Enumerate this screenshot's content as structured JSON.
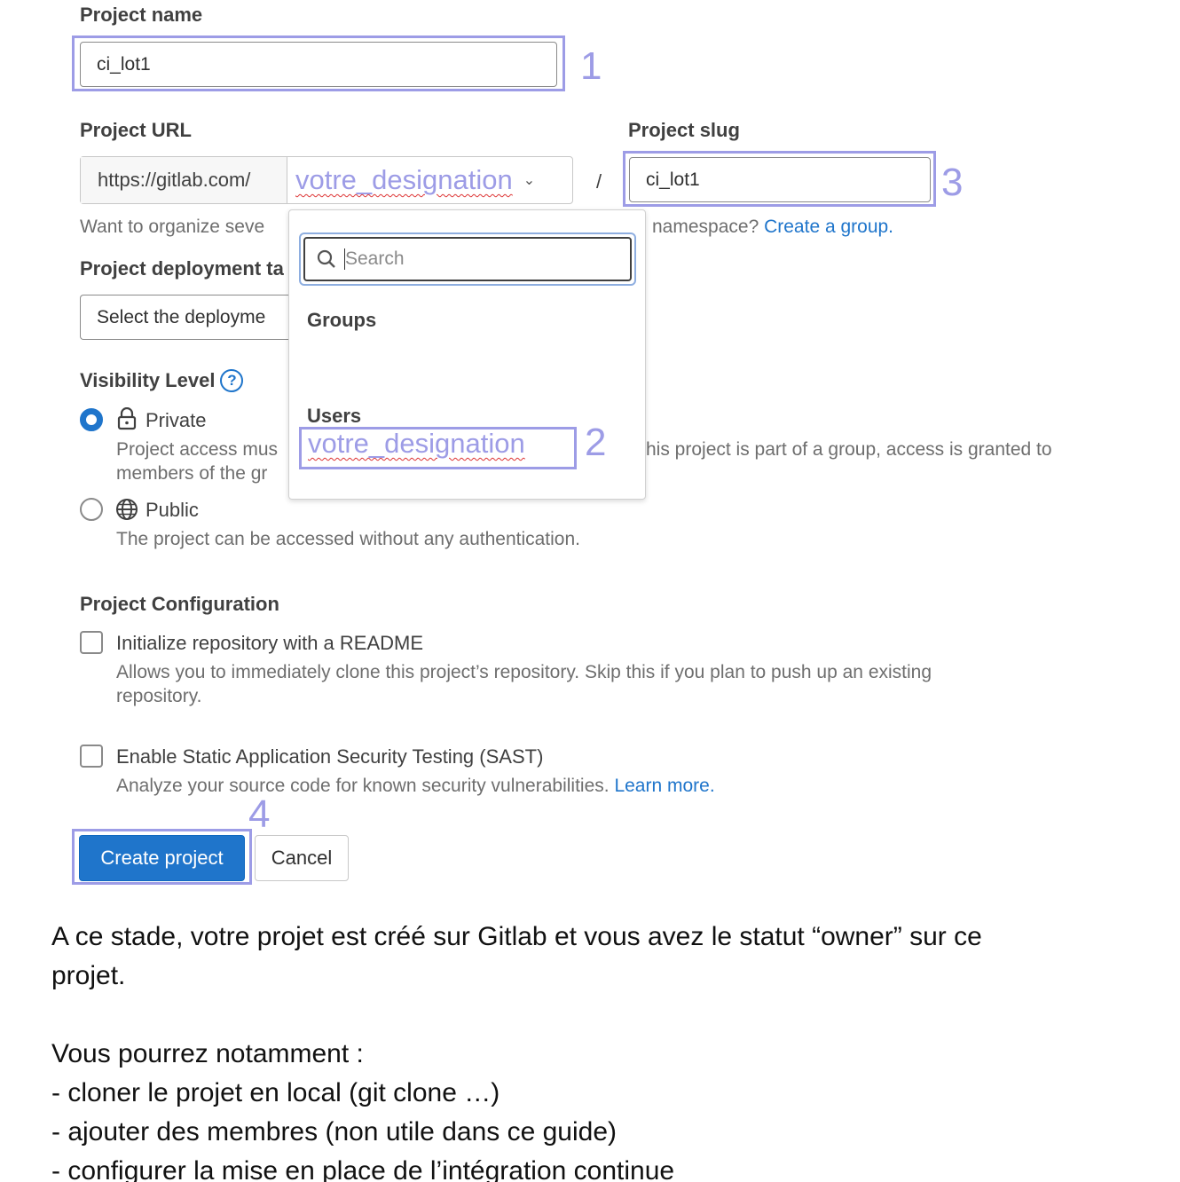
{
  "form": {
    "project_name_label": "Project name",
    "project_name_value": "ci_lot1",
    "project_url_label": "Project URL",
    "url_prefix": "https://gitlab.com/",
    "namespace_value": "votre_designation",
    "separator": "/",
    "project_slug_label": "Project slug",
    "project_slug_value": "ci_lot1",
    "namespace_help_left": "Want to organize seve",
    "namespace_help_right": "namespace?",
    "create_group_link": "Create a group.",
    "deployment_label": "Project deployment ta",
    "deployment_placeholder": "Select the deployme",
    "visibility_label": "Visibility Level",
    "private_label": "Private",
    "private_desc_line1_left": "Project access mus",
    "private_desc_line1_right": "his project is part of a group, access is granted to",
    "private_desc_line2": "members of the gr",
    "public_label": "Public",
    "public_desc": "The project can be accessed without any authentication.",
    "config_label": "Project Configuration",
    "readme_label": "Initialize repository with a README",
    "readme_desc_line1": "Allows you to immediately clone this project’s repository. Skip this if you plan to push up an existing",
    "readme_desc_line2": "repository.",
    "sast_label": "Enable Static Application Security Testing (SAST)",
    "sast_desc": "Analyze your source code for known security vulnerabilities.",
    "learn_more": "Learn more.",
    "create_button": "Create project",
    "cancel_button": "Cancel"
  },
  "dropdown": {
    "search_placeholder": "Search",
    "groups_heading": "Groups",
    "users_heading": "Users",
    "user_item": "votre_designation"
  },
  "annotations": [
    "1",
    "2",
    "3",
    "4"
  ],
  "doc": {
    "para1_line1": "A ce stade, votre projet est créé sur Gitlab et vous avez le statut “owner” sur ce",
    "para1_line2": "projet.",
    "para2_intro": "Vous pourrez notamment :",
    "bullets": [
      "- cloner le projet en local (git clone …)",
      "- ajouter des membres (non utile dans ce guide)",
      "- configurer la mise en place de l’intégration continue"
    ]
  },
  "colors": {
    "annotation": "#9d9ce6",
    "primary": "#1f75cb",
    "link": "#1f75cb"
  }
}
